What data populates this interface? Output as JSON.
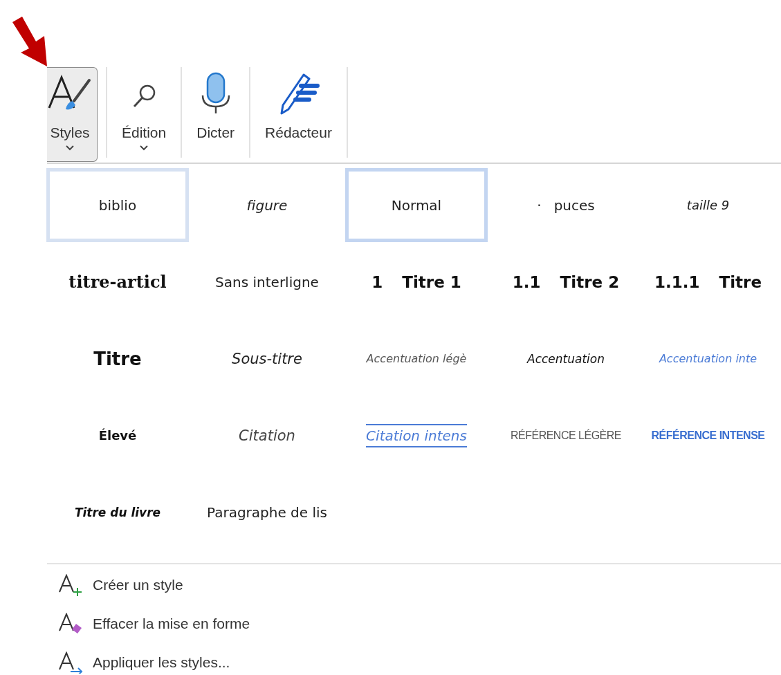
{
  "ribbon": {
    "buttons": [
      {
        "kind": "styles",
        "label": "Styles",
        "pressed": true,
        "has_menu": true
      },
      {
        "kind": "search",
        "label": "Édition",
        "pressed": false,
        "has_menu": true
      },
      {
        "kind": "mic",
        "label": "Dicter",
        "pressed": false,
        "has_menu": false
      },
      {
        "kind": "editor",
        "label": "Rédacteur",
        "pressed": false,
        "has_menu": false
      }
    ]
  },
  "gallery": {
    "styles": [
      {
        "kind": "plain",
        "label": "biblio",
        "selected": false,
        "hovered": true
      },
      {
        "kind": "italic",
        "label": "figure",
        "selected": false,
        "hovered": false
      },
      {
        "kind": "plain",
        "label": "Normal",
        "selected": true,
        "hovered": false
      },
      {
        "kind": "bullet",
        "marker": "·",
        "label": "puces",
        "selected": false,
        "hovered": false
      },
      {
        "kind": "small-italic",
        "label": "taille 9",
        "selected": false,
        "hovered": false
      },
      {
        "kind": "serif-bold",
        "label": "titre-articl",
        "selected": false,
        "hovered": false
      },
      {
        "kind": "plain",
        "label": "Sans interligne",
        "selected": false,
        "hovered": false
      },
      {
        "kind": "heading",
        "marker": "1",
        "label": "Titre 1",
        "selected": false,
        "hovered": false
      },
      {
        "kind": "heading",
        "marker": "1.1",
        "label": "Titre 2",
        "selected": false,
        "hovered": false
      },
      {
        "kind": "heading",
        "marker": "1.1.1",
        "label": "Titre",
        "selected": false,
        "hovered": false
      },
      {
        "kind": "title",
        "label": "Titre",
        "selected": false,
        "hovered": false
      },
      {
        "kind": "subtitle",
        "label": "Sous-titre",
        "selected": false,
        "hovered": false
      },
      {
        "kind": "emphasis-light",
        "label": "Accentuation légè",
        "selected": false,
        "hovered": false
      },
      {
        "kind": "emphasis",
        "label": "Accentuation",
        "selected": false,
        "hovered": false
      },
      {
        "kind": "emphasis-intense",
        "label": "Accentuation inte",
        "selected": false,
        "hovered": false
      },
      {
        "kind": "strong",
        "label": "Élevé",
        "selected": false,
        "hovered": false
      },
      {
        "kind": "quote",
        "label": "Citation",
        "selected": false,
        "hovered": false
      },
      {
        "kind": "quote-intense",
        "label": "Citation intens",
        "selected": false,
        "hovered": false
      },
      {
        "kind": "reference-light",
        "label": "RÉFÉRENCE LÉGÈRE",
        "selected": false,
        "hovered": false
      },
      {
        "kind": "reference-intense",
        "label": "RÉFÉRENCE INTENSE",
        "selected": false,
        "hovered": false
      },
      {
        "kind": "book",
        "label": "Titre du livre",
        "selected": false,
        "hovered": false
      },
      {
        "kind": "plain",
        "label": "Paragraphe de lis",
        "selected": false,
        "hovered": false
      }
    ]
  },
  "menu": [
    {
      "kind": "create",
      "label": "Créer un style"
    },
    {
      "kind": "clear",
      "label": "Effacer la mise en forme"
    },
    {
      "kind": "apply",
      "label": "Appliquer les styles..."
    }
  ]
}
